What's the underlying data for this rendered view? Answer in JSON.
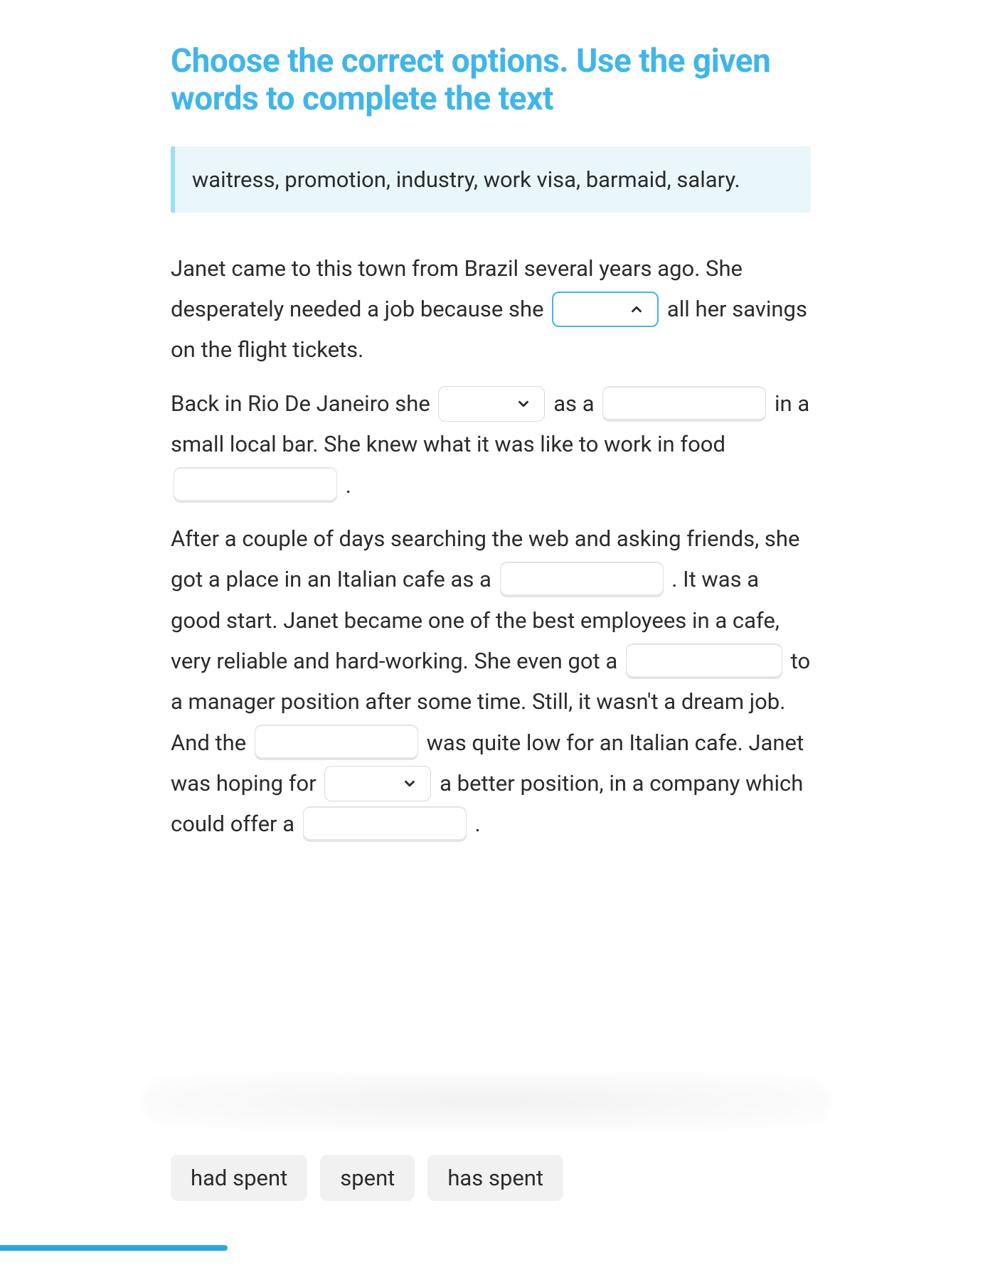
{
  "title": "Choose the correct options. Use the given words to complete the text",
  "wordbank": "waitress, promotion, industry, work visa, barmaid, salary.",
  "passage": {
    "p1": {
      "t1": "Janet came to this town from Brazil several years ago. She desperately needed a job because she ",
      "t2": " all her savings on the flight tickets."
    },
    "p2": {
      "t1": "Back in Rio De Janeiro she ",
      "t2": " as a ",
      "t3": " in a small local bar. She knew what it was like to work in food ",
      "t4": " ."
    },
    "p3": {
      "t1": "After a couple of days searching the web and asking friends, she got a place in an Italian cafe as a ",
      "t2": ". It was a good start. Janet became one of the best employees in a cafe, very reliable and hard-working. She even got a ",
      "t3": " to a manager position after some time. Still, it wasn't a dream job. And the ",
      "t4": " was quite low for an Italian cafe. Janet was hoping for ",
      "t5": " a better position, in a company which could offer a ",
      "t6": "."
    }
  },
  "active_dropdown_options": [
    "had spent",
    "spent",
    "has spent"
  ],
  "progress_percent": 23
}
